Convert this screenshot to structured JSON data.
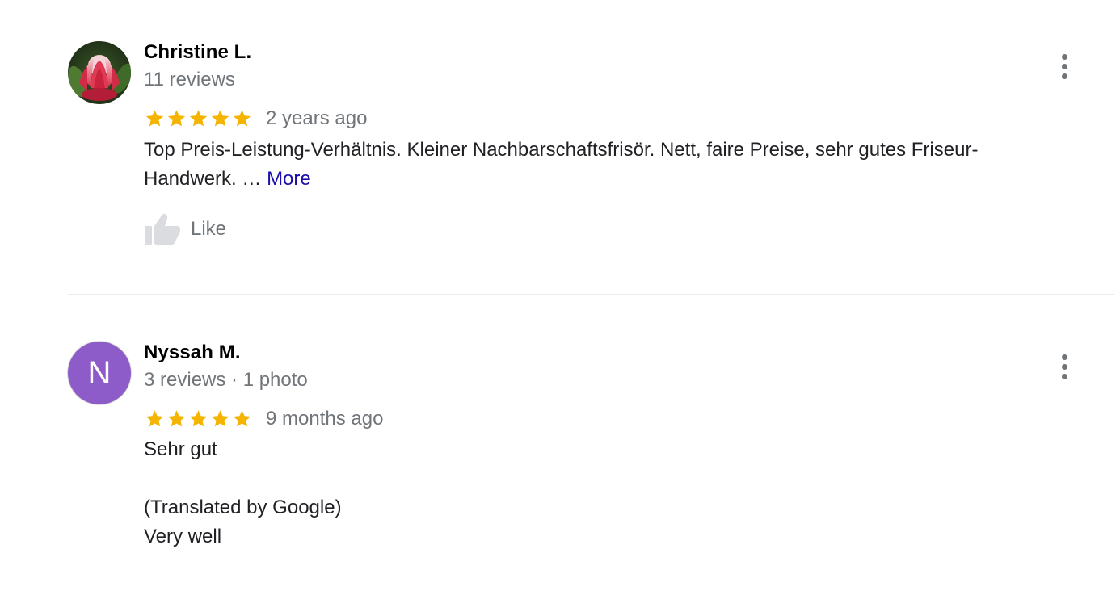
{
  "reviews": [
    {
      "author": "Christine L.",
      "meta": "11 reviews",
      "rating": 5,
      "max_rating": 5,
      "time": "2 years ago",
      "text": "Top Preis-Leistung-Verhältnis. Kleiner Nachbarschaftsfrisör. Nett, faire Preise, sehr gutes Friseur-Handwerk. …",
      "more_label": "More",
      "like_label": "Like",
      "avatar_icon": "protea-flower-photo",
      "menu_icon": "more-vert-icon"
    },
    {
      "author": "Nyssah M.",
      "meta": "3 reviews · 1 photo",
      "rating": 5,
      "max_rating": 5,
      "time": "9 months ago",
      "avatar_letter": "N",
      "text": "Sehr gut",
      "translated_label": "(Translated by Google)",
      "translation": "Very well",
      "menu_icon": "more-vert-icon"
    }
  ],
  "colors": {
    "star": "#f5b400",
    "avatar_purple": "#8e5cc9",
    "link": "#1a0dab",
    "secondary_text": "#70757a",
    "like_icon": "#dadce0"
  }
}
